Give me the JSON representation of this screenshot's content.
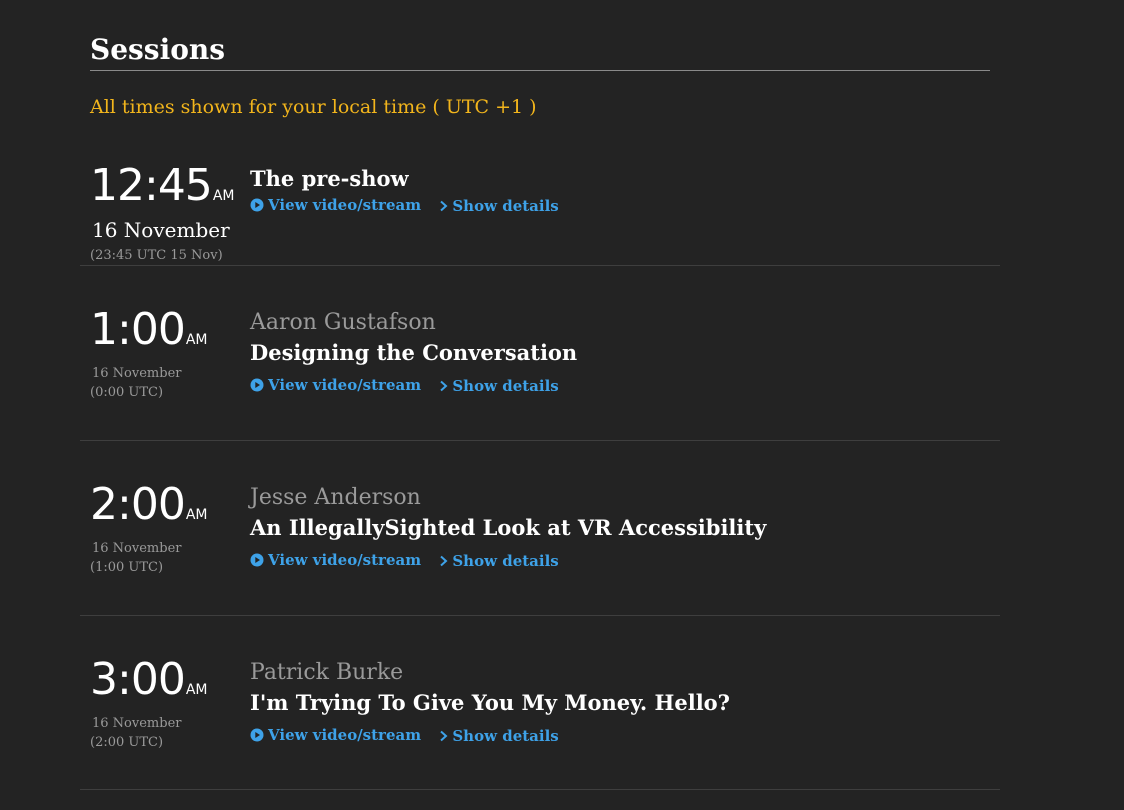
{
  "page": {
    "heading": "Sessions",
    "timezone_note": "All times shown for your local time ( UTC +1 )"
  },
  "colors": {
    "accent_blue": "#3ea2e8",
    "timezone_yellow": "#f2b51c",
    "background": "#232323"
  },
  "links": {
    "video": "View video/stream",
    "details": "Show details"
  },
  "sessions": [
    {
      "time": "12:45",
      "ampm": "AM",
      "date": "16 November",
      "utc": "(23:45 UTC 15 Nov)",
      "speaker": "",
      "title": "The pre-show"
    },
    {
      "time": "1:00",
      "ampm": "AM",
      "date": "16 November",
      "utc": "(0:00 UTC)",
      "speaker": "Aaron Gustafson",
      "title": "Designing the Conversation"
    },
    {
      "time": "2:00",
      "ampm": "AM",
      "date": "16 November",
      "utc": "(1:00 UTC)",
      "speaker": "Jesse Anderson",
      "title": "An IllegallySighted Look at VR Accessibility"
    },
    {
      "time": "3:00",
      "ampm": "AM",
      "date": "16 November",
      "utc": "(2:00 UTC)",
      "speaker": "Patrick Burke",
      "title": "I'm Trying To Give You My Money. Hello?"
    }
  ]
}
